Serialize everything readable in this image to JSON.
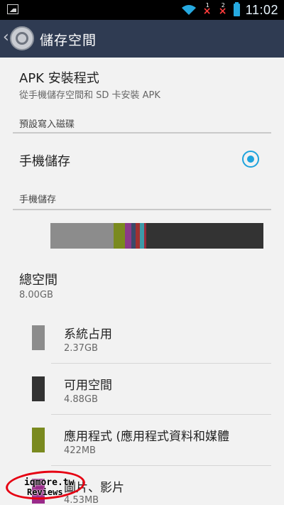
{
  "status_bar": {
    "time": "11:02",
    "sim1_number": "1",
    "sim2_number": "2",
    "no_signal_mark": "×",
    "icons": [
      "image-icon",
      "wifi-icon",
      "sim1-no-signal-icon",
      "sim2-no-signal-icon",
      "battery-icon"
    ],
    "time_color": "#eaf6ff"
  },
  "app_bar": {
    "title": "儲存空間",
    "back_glyph": "‹",
    "background": "#2f3b52"
  },
  "apk_install": {
    "title": "APK 安裝程式",
    "subtitle": "從手機儲存空間和 SD 卡安裝 APK"
  },
  "default_write_disk": {
    "header": "預設寫入磁碟",
    "option_label": "手機儲存",
    "selected": true,
    "accent": "#1ea3dc"
  },
  "phone_storage": {
    "header": "手機儲存",
    "usage_segments": [
      {
        "name": "system",
        "fraction": 0.296,
        "color": "#8c8c8c"
      },
      {
        "name": "apps",
        "fraction": 0.053,
        "color": "#7a8a1f"
      },
      {
        "name": "pictures",
        "fraction": 0.03,
        "color": "#8a3a8a"
      },
      {
        "name": "audio",
        "fraction": 0.02,
        "color": "#3a4a6a"
      },
      {
        "name": "downloads",
        "fraction": 0.022,
        "color": "#a03030"
      },
      {
        "name": "misc",
        "fraction": 0.018,
        "color": "#3d9aa8"
      },
      {
        "name": "other",
        "fraction": 0.011,
        "color": "#9a2a3a"
      },
      {
        "name": "free",
        "fraction": 0.55,
        "color": "#333333"
      }
    ]
  },
  "total_space": {
    "title": "總空間",
    "value": "8.00GB"
  },
  "categories": [
    {
      "title": "系統占用",
      "size": "2.37GB",
      "color": "#8c8c8c"
    },
    {
      "title": "可用空間",
      "size": "4.88GB",
      "color": "#333333"
    },
    {
      "title": "應用程式 (應用程式資料和媒體",
      "size": "422MB",
      "color": "#7a8a1f"
    },
    {
      "title": "圖片、影片",
      "size": "4.53MB",
      "color": "#9a2a8a"
    }
  ],
  "watermark": {
    "line1": "iqmore.tw",
    "line2": "Reviews"
  }
}
